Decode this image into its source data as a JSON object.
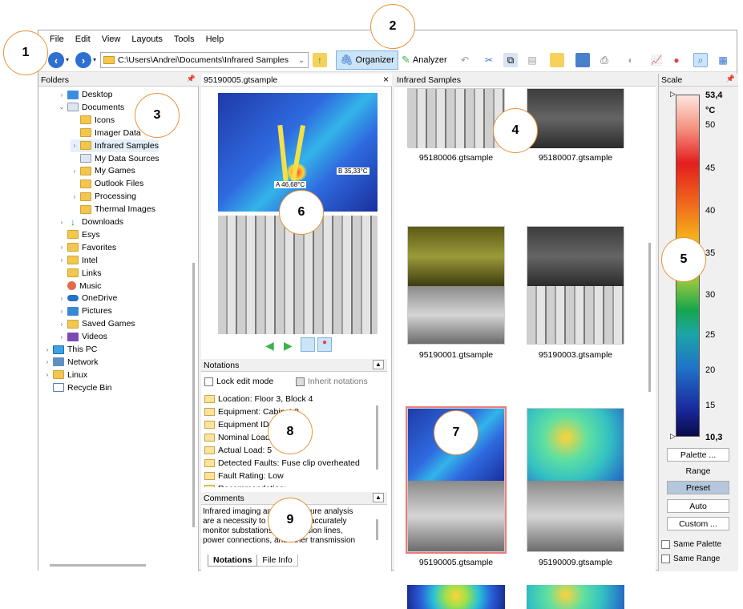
{
  "menu": [
    "File",
    "Edit",
    "View",
    "Layouts",
    "Tools",
    "Help"
  ],
  "toolbar": {
    "path": "C:\\Users\\Andrei\\Documents\\Infrared Samples",
    "organizer_label": "Organizer",
    "analyzer_label": "Analyzer"
  },
  "folders": {
    "title": "Folders",
    "items": [
      {
        "label": "Desktop",
        "level": 2,
        "icon": "desktop-icon",
        "expander": "›"
      },
      {
        "label": "Documents",
        "level": 2,
        "icon": "documents-icon",
        "expander": "⌄"
      },
      {
        "label": "Icons",
        "level": 3,
        "icon": "folder-icon",
        "expander": ""
      },
      {
        "label": "Imager Data",
        "level": 3,
        "icon": "folder-icon",
        "expander": ""
      },
      {
        "label": "Infrared Samples",
        "level": 3,
        "icon": "folder-icon",
        "expander": "›",
        "selected": true
      },
      {
        "label": "My Data Sources",
        "level": 3,
        "icon": "data-sources-icon",
        "expander": ""
      },
      {
        "label": "My Games",
        "level": 3,
        "icon": "folder-icon",
        "expander": "›"
      },
      {
        "label": "Outlook Files",
        "level": 3,
        "icon": "folder-icon",
        "expander": ""
      },
      {
        "label": "Processing",
        "level": 3,
        "icon": "folder-icon",
        "expander": "›"
      },
      {
        "label": "Thermal Images",
        "level": 3,
        "icon": "folder-icon",
        "expander": ""
      },
      {
        "label": "Downloads",
        "level": 2,
        "icon": "download-icon",
        "expander": "›"
      },
      {
        "label": "Esys",
        "level": 2,
        "icon": "folder-icon",
        "expander": ""
      },
      {
        "label": "Favorites",
        "level": 2,
        "icon": "folder-icon",
        "expander": "›"
      },
      {
        "label": "Intel",
        "level": 2,
        "icon": "folder-icon",
        "expander": "›"
      },
      {
        "label": "Links",
        "level": 2,
        "icon": "folder-icon",
        "expander": ""
      },
      {
        "label": "Music",
        "level": 2,
        "icon": "music-icon",
        "expander": ""
      },
      {
        "label": "OneDrive",
        "level": 2,
        "icon": "cloud-icon",
        "expander": "›"
      },
      {
        "label": "Pictures",
        "level": 2,
        "icon": "pictures-icon",
        "expander": "›"
      },
      {
        "label": "Saved Games",
        "level": 2,
        "icon": "folder-icon",
        "expander": "›"
      },
      {
        "label": "Videos",
        "level": 2,
        "icon": "videos-icon",
        "expander": "›"
      },
      {
        "label": "This PC",
        "level": 1,
        "icon": "pc-icon",
        "expander": "›"
      },
      {
        "label": "Network",
        "level": 1,
        "icon": "network-icon",
        "expander": "›"
      },
      {
        "label": "Linux",
        "level": 1,
        "icon": "folder-icon",
        "expander": "›"
      },
      {
        "label": "Recycle Bin",
        "level": 1,
        "icon": "recycle-bin-icon",
        "expander": ""
      }
    ]
  },
  "viewer": {
    "title": "95190005.gtsample",
    "marker_a": "A 46,68°C",
    "marker_b": "B 35,33°C"
  },
  "notations": {
    "title": "Notations",
    "lock_label": "Lock edit mode",
    "inherit_label": "Inherit notations",
    "items": [
      "Location: Floor 3, Block 4",
      "Equipment: Cabinet 3",
      "Equipment ID",
      "Nominal Load",
      "Actual Load: 5",
      "Detected Faults: Fuse clip overheated",
      "Fault Rating: Low",
      "Recommendation:"
    ]
  },
  "comments": {
    "title": "Comments",
    "text_lines": [
      "Infrared imaging and temperature analysis",
      "are a necessity to quickly and accurately",
      "monitor substations, transmission lines,",
      "power connections, and other transmission"
    ]
  },
  "tabs": [
    "Notations",
    "File Info"
  ],
  "thumbnails": {
    "title": "Infrared Samples",
    "items": [
      {
        "caption": "95180006.gtsample",
        "top_style": "photo-cab",
        "bottom_style": ""
      },
      {
        "caption": "95180007.gtsample",
        "top_style": "photo-dark",
        "bottom_style": ""
      },
      {
        "caption": "95190001.gtsample",
        "top_style": "photo-yellow",
        "bottom_style": "photo-gray"
      },
      {
        "caption": "95190003.gtsample",
        "top_style": "photo-dark",
        "bottom_style": "photo-cab"
      },
      {
        "caption": "95190005.gtsample",
        "top_style": "thermal",
        "bottom_style": "photo-gray",
        "selected": true
      },
      {
        "caption": "95190009.gtsample",
        "top_style": "photo-green",
        "bottom_style": "photo-gray"
      }
    ]
  },
  "scale": {
    "title": "Scale",
    "max": "53,4",
    "unit": "°C",
    "ticks": [
      "50",
      "45",
      "40",
      "35",
      "30",
      "25",
      "20",
      "15"
    ],
    "min": "10,3",
    "palette_button": "Palette ...",
    "range_label": "Range",
    "preset_button": "Preset",
    "auto_button": "Auto",
    "custom_button": "Custom ...",
    "same_palette": "Same Palette",
    "same_range": "Same Range"
  },
  "callouts": [
    "1",
    "2",
    "3",
    "4",
    "5",
    "6",
    "7",
    "8",
    "9"
  ]
}
